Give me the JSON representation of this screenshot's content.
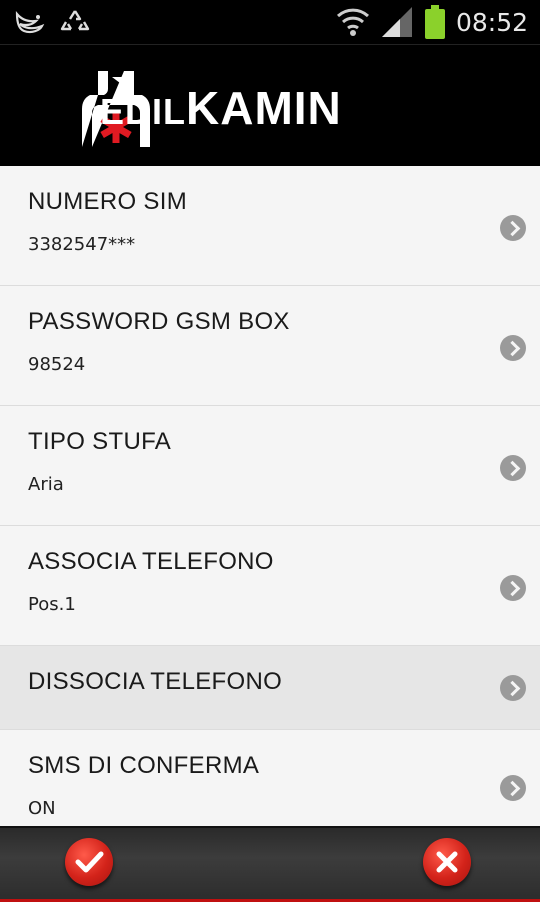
{
  "status_bar": {
    "time": "08:52",
    "icons": [
      "bird-notification-icon",
      "recycle-notification-icon",
      "wifi-icon",
      "signal-icon",
      "battery-icon"
    ]
  },
  "header": {
    "brand_part1": "EDIL",
    "brand_part2": "KAMIN",
    "accent_color": "#e01a22"
  },
  "settings": {
    "items": [
      {
        "title": "NUMERO SIM",
        "value": "3382547***"
      },
      {
        "title": "PASSWORD GSM BOX",
        "value": "98524"
      },
      {
        "title": "TIPO STUFA",
        "value": "Aria"
      },
      {
        "title": "ASSOCIA TELEFONO",
        "value": "Pos.1"
      },
      {
        "title": "DISSOCIA TELEFONO",
        "value": ""
      },
      {
        "title": "SMS DI CONFERMA",
        "value": "ON"
      }
    ]
  },
  "actions": {
    "confirm_icon": "checkmark-icon",
    "cancel_icon": "close-icon"
  }
}
